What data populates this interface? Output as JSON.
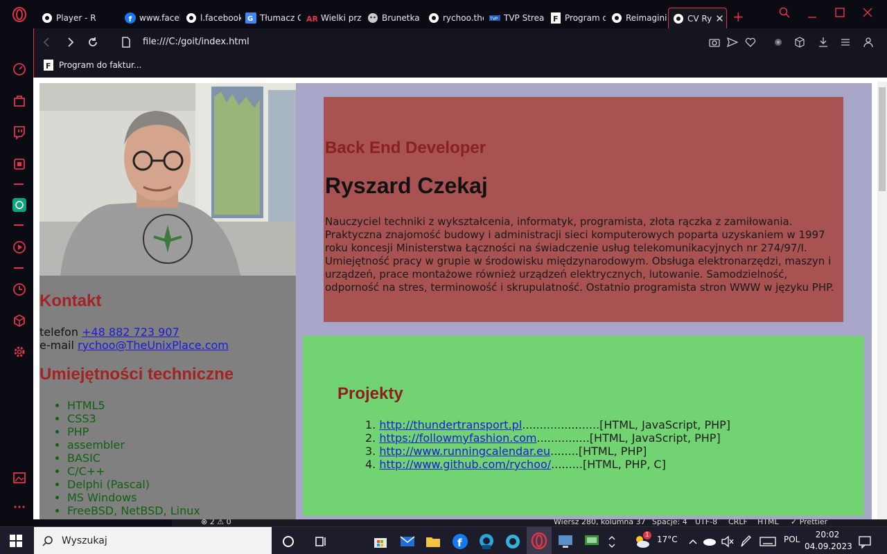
{
  "browser": {
    "tabs": [
      {
        "title": "Player - R",
        "icon": "opera-icon"
      },
      {
        "title": "www.faceb",
        "icon": "facebook-icon"
      },
      {
        "title": "l.facebook",
        "icon": "globe-icon"
      },
      {
        "title": "Tłumacz G",
        "icon": "translate-icon"
      },
      {
        "title": "Wielki prze",
        "icon": "ar-icon"
      },
      {
        "title": "Brunetka n",
        "icon": "wolf-icon"
      },
      {
        "title": "rychoo.the",
        "icon": "globe-icon"
      },
      {
        "title": "TVP Strean",
        "icon": "tvp-icon"
      },
      {
        "title": "Program d",
        "icon": "f-icon"
      },
      {
        "title": "Reimaginii",
        "icon": "globe-icon"
      },
      {
        "title": "CV Ry",
        "icon": "globe-icon",
        "active": true
      }
    ],
    "url": "file:///C:/goit/index.html",
    "bookmarks": [
      {
        "label": "Program do faktur..."
      }
    ]
  },
  "cv": {
    "contact_heading": "Kontakt",
    "phone_label": "telefon",
    "phone": "+48 882 723 907",
    "email_label": "e-mail",
    "email": "rychoo@TheUnixPlace.com",
    "skills_heading": "Umiejętności techniczne",
    "skills": [
      "HTML5",
      "CSS3",
      "PHP",
      "assembler",
      "BASIC",
      "C/C++",
      "Delphi (Pascal)",
      "MS Windows",
      "FreeBSD, NetBSD, Linux"
    ],
    "role": "Back End Developer",
    "name": "Ryszard Czekaj",
    "bio": "Nauczyciel techniki z wykształcenia, informatyk, programista, złota rączka z zamiłowania. Praktyczna znajomość budowy i administracji sieci komputerowych poparta uzyskaniem w 1997 roku koncesji Ministerstwa Łączności na świadczenie usług telekomunikacyjnych nr 274/97/I. Umiejętność pracy w grupie w środowisku międzynarodowym. Obsługa elektronarzędzi, maszyn i urządzeń, prace montażowe również urządzeń elektrycznych, lutowanie. Samodzielność, odporność na stres, terminowość i skrupulatność. Ostatnio programista stron WWW w języku PHP.",
    "projects_heading": "Projekty",
    "projects": [
      {
        "url": "http://thundertransport.pl",
        "dots": "......................",
        "tech": "[HTML, JavaScript, PHP]"
      },
      {
        "url": "https://followmyfashion.com",
        "dots": "...............",
        "tech": "[HTML, JavaScript, PHP]"
      },
      {
        "url": "http://www.runningcalendar.eu",
        "dots": "........",
        "tech": "[HTML, PHP]"
      },
      {
        "url": "http://www.github.com/rychoo/",
        "dots": ".........",
        "tech": "[HTML, PHP, C]"
      }
    ]
  },
  "editor_status": {
    "problems": "⊗ 2 ⚠ 0",
    "position": "Wiersz 280, kolumna 37",
    "spaces": "Spacje: 4",
    "encoding": "UTF-8",
    "eol": "CRLF",
    "language": "HTML",
    "prettier": "✓ Prettier"
  },
  "taskbar": {
    "search_placeholder": "Wyszukaj",
    "weather": "17°C",
    "language": "POL",
    "time": "20:02",
    "date": "04.09.2023",
    "badge": "1"
  }
}
